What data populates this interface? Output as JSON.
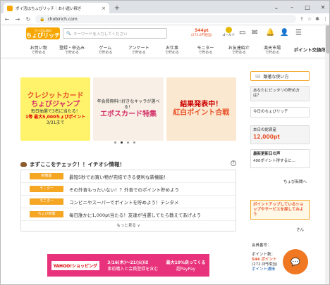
{
  "browser": {
    "tab_title": "ポイ活はちょびリッチ｜お小遣い稼ぎ",
    "url": "chobirich.com",
    "new_tab": "+",
    "tab_close": "×"
  },
  "header": {
    "logo_line1": "ポイ活は無料",
    "logo_text": "ちょびリッチ",
    "search_placeholder": "キーワードを入力してください",
    "points": "544pt",
    "points_yen": "(272.0円相当)",
    "gold_label": "ゴールド"
  },
  "nav": {
    "items": [
      {
        "top": "お買い物",
        "bottom": "で貯める"
      },
      {
        "top": "登録・申込み",
        "bottom": "で貯める"
      },
      {
        "top": "ゲーム",
        "bottom": "で貯める"
      },
      {
        "top": "アンケート",
        "bottom": "で貯める"
      },
      {
        "top": "お仕事",
        "bottom": "で貯める"
      },
      {
        "top": "モニター",
        "bottom": "で貯める"
      },
      {
        "top": "お友達紹介",
        "bottom": "で貯める"
      },
      {
        "top": "楽天市場",
        "bottom": "で貯める"
      }
    ],
    "end_item": "ポイント交換所"
  },
  "banners": [
    {
      "title": "クレジットカード",
      "sub": "ちょびジャンプ",
      "note": "毎日抽選で3名に当たる！",
      "prize": "1等 最大5,000ちょびポイント",
      "date": "3/31まで"
    },
    {
      "title": "エポスカード特集",
      "sub": "年会費無料!!好きなキャラが選べる！"
    },
    {
      "title": "結果発表中！",
      "sub": "紅白ポイント合戦"
    }
  ],
  "section": {
    "title": "まずここをチェック！！イチオシ情報！",
    "help": "?",
    "news": [
      {
        "tag": "新機能",
        "text": "最短5秒でお買い物が完結できる便利な新機能！"
      },
      {
        "tag": "モニター",
        "text": "その外食もったいない！？外食でのポイント貯めよう"
      },
      {
        "tag": "モニター",
        "text": "コンビニやスーパーでポイントを貯めよう！テンタメ"
      },
      {
        "tag": "ちょび新聞",
        "text": "毎日誰かに1,000pt当たる！友達が当選してたら教えてあげよう"
      }
    ],
    "more": "もっと見る ∨"
  },
  "ad": {
    "date": "3/16(木)～21(火)は",
    "line2": "事前購入と会員登録を含む",
    "badge": "最大10%戻ってくる",
    "logo": "超PayPay",
    "yahoo": "YAHOO!ショッピング"
  },
  "right": {
    "guide": "顕著な使い方",
    "recommend_title": "あなたにピッタリの貯め方は？",
    "recommend_sub": "今日のちょびリッチ",
    "balance_label": "本日の総資産",
    "balance_value": "12,000pt",
    "cheer_label": "最新更新日の声",
    "cheer_text": "400ポイント得するに…",
    "link_label": "ちょび新聞へ",
    "promo": "ポイントアップしているショップやサービスを探してみよう",
    "user_suffix": "さん",
    "member_label": "会員番号：",
    "points_label": "ポイント数：",
    "points_value": "544 ポイント",
    "points_yen": "(272.0円相当)",
    "history": "ポイント通帳"
  }
}
